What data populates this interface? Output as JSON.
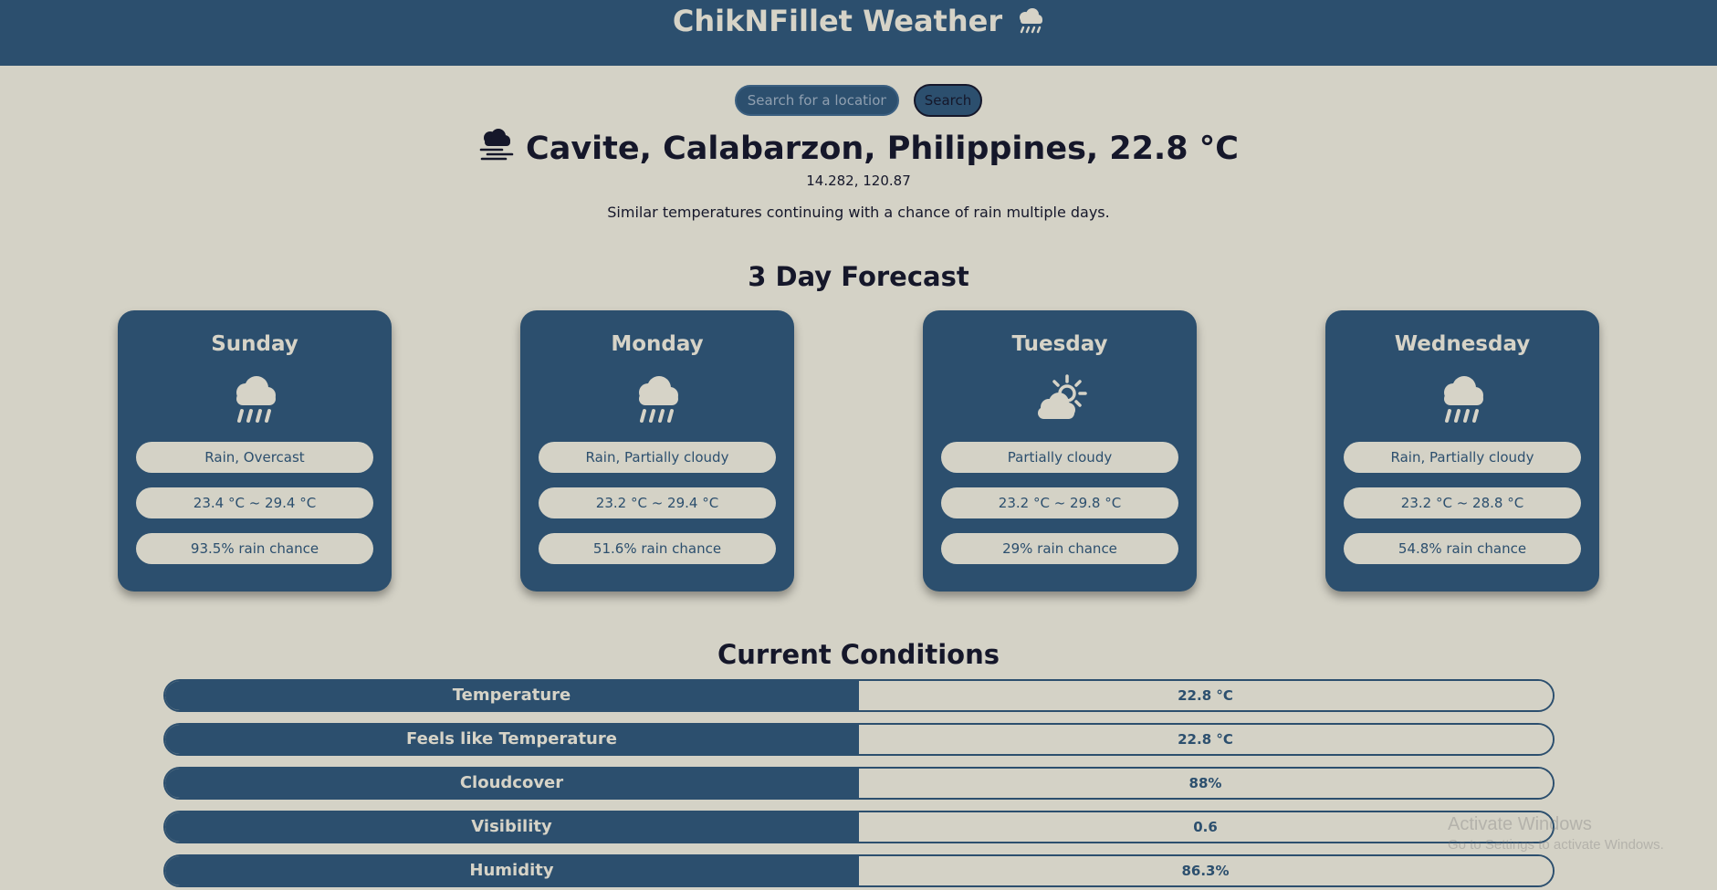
{
  "header": {
    "title": "ChikNFillet Weather",
    "icon": "rain-cloud-icon"
  },
  "search": {
    "placeholder": "Search for a location",
    "value": "",
    "button_label": "Search"
  },
  "location": {
    "name": "Cavite, Calabarzon, Philippines,",
    "temperature": "22.8 °C",
    "icon": "fog-icon",
    "coords": "14.282, 120.87",
    "description": "Similar temperatures continuing with a chance of rain multiple days."
  },
  "forecast": {
    "title": "3 Day Forecast",
    "days": [
      {
        "name": "Sunday",
        "icon": "rain-cloud-icon",
        "conditions": "Rain, Overcast",
        "temp_range": "23.4 °C ~ 29.4 °C",
        "rain_chance": "93.5% rain chance"
      },
      {
        "name": "Monday",
        "icon": "rain-cloud-icon",
        "conditions": "Rain, Partially cloudy",
        "temp_range": "23.2 °C ~ 29.4 °C",
        "rain_chance": "51.6% rain chance"
      },
      {
        "name": "Tuesday",
        "icon": "partly-cloudy-icon",
        "conditions": "Partially cloudy",
        "temp_range": "23.2 °C ~ 29.8 °C",
        "rain_chance": "29% rain chance"
      },
      {
        "name": "Wednesday",
        "icon": "rain-cloud-icon",
        "conditions": "Rain, Partially cloudy",
        "temp_range": "23.2 °C ~ 28.8 °C",
        "rain_chance": "54.8% rain chance"
      }
    ]
  },
  "conditions": {
    "title": "Current Conditions",
    "rows": [
      {
        "label": "Temperature",
        "value": "22.8 °C"
      },
      {
        "label": "Feels like Temperature",
        "value": "22.8 °C"
      },
      {
        "label": "Cloudcover",
        "value": "88%"
      },
      {
        "label": "Visibility",
        "value": "0.6"
      },
      {
        "label": "Humidity",
        "value": "86.3%"
      }
    ]
  },
  "watermark": {
    "title": "Activate Windows",
    "subtitle": "Go to Settings to activate Windows."
  },
  "colors": {
    "primary": "#2c4f6e",
    "background": "#d4d2c6",
    "text_dark": "#15172a",
    "text_light": "#d6d3c7"
  }
}
